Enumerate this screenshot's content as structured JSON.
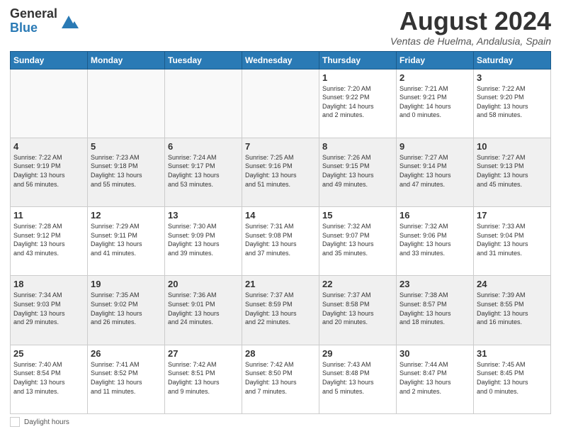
{
  "logo": {
    "general": "General",
    "blue": "Blue"
  },
  "title": "August 2024",
  "subtitle": "Ventas de Huelma, Andalusia, Spain",
  "days_of_week": [
    "Sunday",
    "Monday",
    "Tuesday",
    "Wednesday",
    "Thursday",
    "Friday",
    "Saturday"
  ],
  "footer": {
    "label": "Daylight hours"
  },
  "weeks": [
    [
      {
        "day": "",
        "info": ""
      },
      {
        "day": "",
        "info": ""
      },
      {
        "day": "",
        "info": ""
      },
      {
        "day": "",
        "info": ""
      },
      {
        "day": "1",
        "info": "Sunrise: 7:20 AM\nSunset: 9:22 PM\nDaylight: 14 hours\nand 2 minutes."
      },
      {
        "day": "2",
        "info": "Sunrise: 7:21 AM\nSunset: 9:21 PM\nDaylight: 14 hours\nand 0 minutes."
      },
      {
        "day": "3",
        "info": "Sunrise: 7:22 AM\nSunset: 9:20 PM\nDaylight: 13 hours\nand 58 minutes."
      }
    ],
    [
      {
        "day": "4",
        "info": "Sunrise: 7:22 AM\nSunset: 9:19 PM\nDaylight: 13 hours\nand 56 minutes."
      },
      {
        "day": "5",
        "info": "Sunrise: 7:23 AM\nSunset: 9:18 PM\nDaylight: 13 hours\nand 55 minutes."
      },
      {
        "day": "6",
        "info": "Sunrise: 7:24 AM\nSunset: 9:17 PM\nDaylight: 13 hours\nand 53 minutes."
      },
      {
        "day": "7",
        "info": "Sunrise: 7:25 AM\nSunset: 9:16 PM\nDaylight: 13 hours\nand 51 minutes."
      },
      {
        "day": "8",
        "info": "Sunrise: 7:26 AM\nSunset: 9:15 PM\nDaylight: 13 hours\nand 49 minutes."
      },
      {
        "day": "9",
        "info": "Sunrise: 7:27 AM\nSunset: 9:14 PM\nDaylight: 13 hours\nand 47 minutes."
      },
      {
        "day": "10",
        "info": "Sunrise: 7:27 AM\nSunset: 9:13 PM\nDaylight: 13 hours\nand 45 minutes."
      }
    ],
    [
      {
        "day": "11",
        "info": "Sunrise: 7:28 AM\nSunset: 9:12 PM\nDaylight: 13 hours\nand 43 minutes."
      },
      {
        "day": "12",
        "info": "Sunrise: 7:29 AM\nSunset: 9:11 PM\nDaylight: 13 hours\nand 41 minutes."
      },
      {
        "day": "13",
        "info": "Sunrise: 7:30 AM\nSunset: 9:09 PM\nDaylight: 13 hours\nand 39 minutes."
      },
      {
        "day": "14",
        "info": "Sunrise: 7:31 AM\nSunset: 9:08 PM\nDaylight: 13 hours\nand 37 minutes."
      },
      {
        "day": "15",
        "info": "Sunrise: 7:32 AM\nSunset: 9:07 PM\nDaylight: 13 hours\nand 35 minutes."
      },
      {
        "day": "16",
        "info": "Sunrise: 7:32 AM\nSunset: 9:06 PM\nDaylight: 13 hours\nand 33 minutes."
      },
      {
        "day": "17",
        "info": "Sunrise: 7:33 AM\nSunset: 9:04 PM\nDaylight: 13 hours\nand 31 minutes."
      }
    ],
    [
      {
        "day": "18",
        "info": "Sunrise: 7:34 AM\nSunset: 9:03 PM\nDaylight: 13 hours\nand 29 minutes."
      },
      {
        "day": "19",
        "info": "Sunrise: 7:35 AM\nSunset: 9:02 PM\nDaylight: 13 hours\nand 26 minutes."
      },
      {
        "day": "20",
        "info": "Sunrise: 7:36 AM\nSunset: 9:01 PM\nDaylight: 13 hours\nand 24 minutes."
      },
      {
        "day": "21",
        "info": "Sunrise: 7:37 AM\nSunset: 8:59 PM\nDaylight: 13 hours\nand 22 minutes."
      },
      {
        "day": "22",
        "info": "Sunrise: 7:37 AM\nSunset: 8:58 PM\nDaylight: 13 hours\nand 20 minutes."
      },
      {
        "day": "23",
        "info": "Sunrise: 7:38 AM\nSunset: 8:57 PM\nDaylight: 13 hours\nand 18 minutes."
      },
      {
        "day": "24",
        "info": "Sunrise: 7:39 AM\nSunset: 8:55 PM\nDaylight: 13 hours\nand 16 minutes."
      }
    ],
    [
      {
        "day": "25",
        "info": "Sunrise: 7:40 AM\nSunset: 8:54 PM\nDaylight: 13 hours\nand 13 minutes."
      },
      {
        "day": "26",
        "info": "Sunrise: 7:41 AM\nSunset: 8:52 PM\nDaylight: 13 hours\nand 11 minutes."
      },
      {
        "day": "27",
        "info": "Sunrise: 7:42 AM\nSunset: 8:51 PM\nDaylight: 13 hours\nand 9 minutes."
      },
      {
        "day": "28",
        "info": "Sunrise: 7:42 AM\nSunset: 8:50 PM\nDaylight: 13 hours\nand 7 minutes."
      },
      {
        "day": "29",
        "info": "Sunrise: 7:43 AM\nSunset: 8:48 PM\nDaylight: 13 hours\nand 5 minutes."
      },
      {
        "day": "30",
        "info": "Sunrise: 7:44 AM\nSunset: 8:47 PM\nDaylight: 13 hours\nand 2 minutes."
      },
      {
        "day": "31",
        "info": "Sunrise: 7:45 AM\nSunset: 8:45 PM\nDaylight: 13 hours\nand 0 minutes."
      }
    ]
  ]
}
